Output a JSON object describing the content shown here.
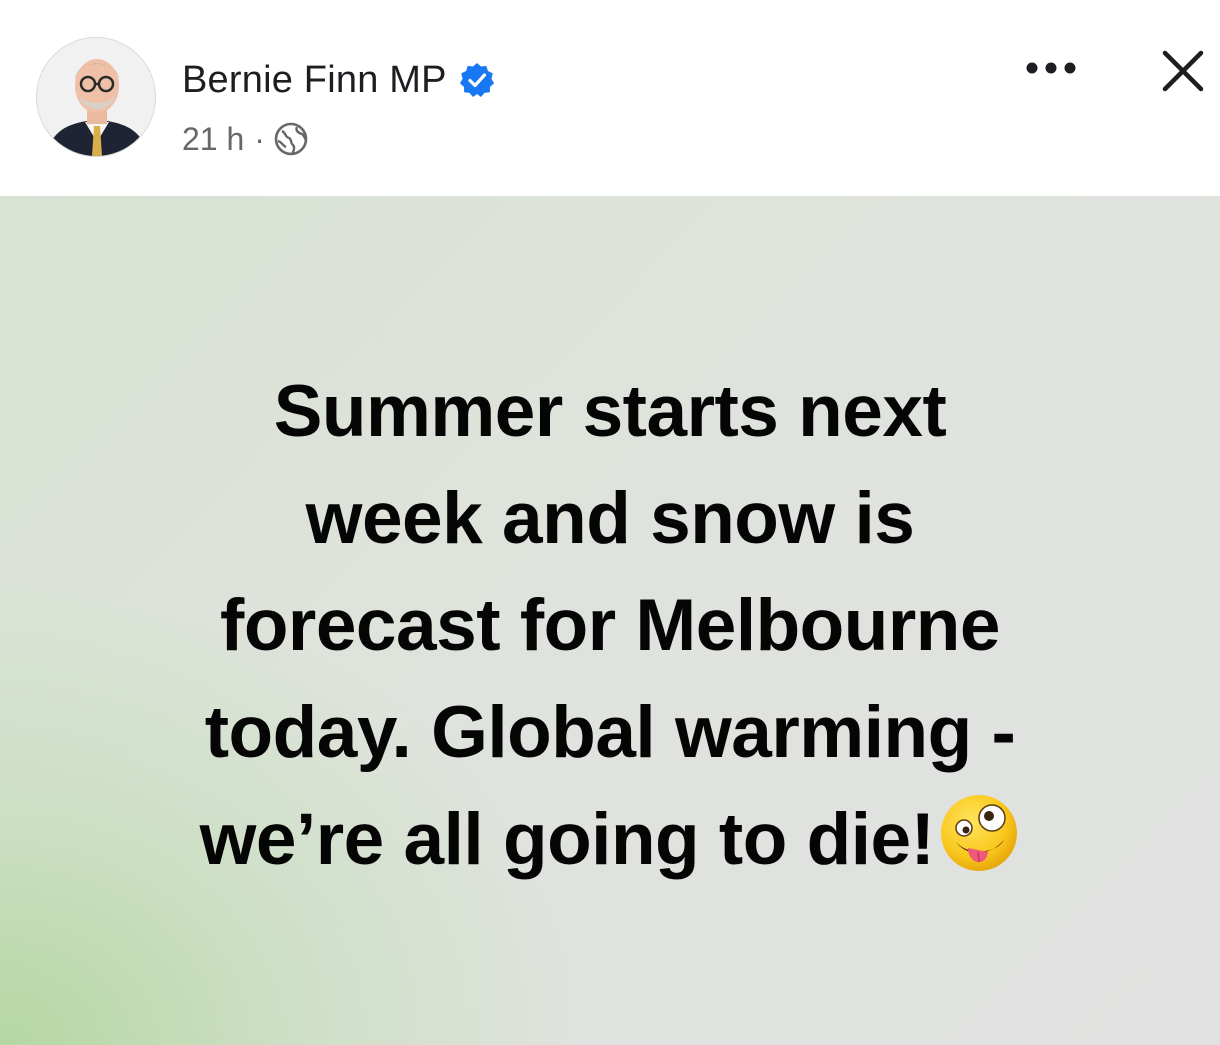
{
  "post": {
    "author": {
      "name": "Bernie Finn MP",
      "verified": true,
      "avatar_icon": "profile-photo-icon"
    },
    "meta": {
      "time": "21 h",
      "separator": "·",
      "audience_icon": "globe-icon"
    },
    "actions": {
      "more_icon": "more-horizontal-icon",
      "close_icon": "close-icon"
    },
    "body": {
      "line1": "Summer starts next",
      "line2": "week and snow is",
      "line3": "forecast for Melbourne",
      "line4": "today. Global warming -",
      "line5": "we’re all going to die!",
      "emoji": "zany-face-emoji"
    },
    "colors": {
      "verified_blue": "#1877f2",
      "text_primary": "#050505",
      "text_secondary": "#65676b",
      "background_green": "#b2d6a0",
      "background_grey": "#e1e1e1"
    }
  }
}
